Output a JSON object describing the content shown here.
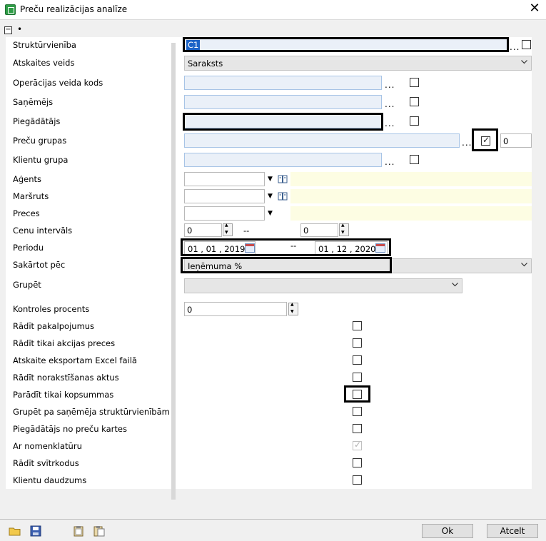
{
  "window": {
    "title": "Preču realizācijas analīze"
  },
  "group": {
    "bullet": "•"
  },
  "fields": {
    "strukturvieniba": {
      "label": "Struktūrvienība",
      "value": "C1"
    },
    "atskaites_veids": {
      "label": "Atskaites veids",
      "value": "Saraksts"
    },
    "operacijas_veida_kods": {
      "label": "Operācijas veida kods"
    },
    "sanemejs": {
      "label": "Saņēmējs"
    },
    "piegadatajs": {
      "label": "Piegādātājs"
    },
    "precu_grupas": {
      "label": "Preču grupas",
      "count": "0"
    },
    "klientu_grupa": {
      "label": "Klientu grupa"
    },
    "agents": {
      "label": "Aģents"
    },
    "marsruts": {
      "label": "Maršruts"
    },
    "preces": {
      "label": "Preces"
    },
    "cenu_intervals": {
      "label": "Cenu intervāls",
      "from": "0",
      "sep": "--",
      "to": "0"
    },
    "periodu": {
      "label": "Periodu",
      "from": "01 , 01 , 2019",
      "sep": "--",
      "to": "01 , 12 , 2020"
    },
    "sakartot_pec": {
      "label": "Sakārtot pēc",
      "value": "Ieņēmuma %"
    },
    "grupet": {
      "label": "Grupēt"
    },
    "kontroles_procents": {
      "label": "Kontroles procents",
      "value": "0"
    }
  },
  "options": [
    {
      "label": "Rādīt pakalpojumus"
    },
    {
      "label": "Rādīt tikai akcijas preces"
    },
    {
      "label": "Atskaite eksportam Excel failā"
    },
    {
      "label": "Rādīt norakstīšanas aktus"
    },
    {
      "label": "Parādīt tikai kopsummas"
    },
    {
      "label": "Grupēt pa saņēmēja struktūrvienībām"
    },
    {
      "label": "Piegādātājs no preču kartes"
    },
    {
      "label": "Ar nomenklatūru"
    },
    {
      "label": "Rādīt svītrkodus"
    },
    {
      "label": "Klientu daudzums"
    }
  ],
  "common": {
    "dots": "..."
  },
  "buttons": {
    "ok": "Ok",
    "cancel": "Atcelt"
  }
}
